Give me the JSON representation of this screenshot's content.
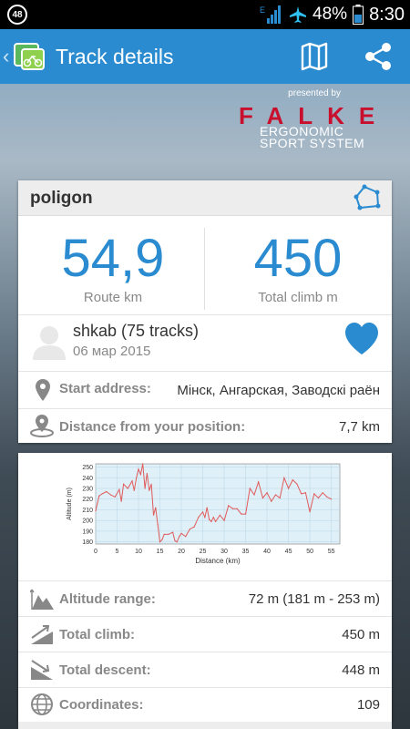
{
  "status_bar": {
    "notification_count": "48",
    "battery_percent": "48%",
    "time": "8:30",
    "network_type": "E",
    "icons": [
      "signal-icon",
      "airplane-icon",
      "battery-icon"
    ]
  },
  "action_bar": {
    "title": "Track details",
    "icons": [
      "back-icon",
      "app-logo-icon",
      "map-icon",
      "share-icon"
    ]
  },
  "sponsor": {
    "presented_by": "presented by",
    "brand": "FALKE",
    "brand_line1": "ERGONOMIC",
    "brand_line2": "SPORT SYSTEM"
  },
  "track": {
    "name": "poligon",
    "route_km": "54,9",
    "route_km_label": "Route km",
    "total_climb": "450",
    "total_climb_label": "Total climb m",
    "user_name": "shkab (75 tracks)",
    "date": "06 мар 2015",
    "rows": [
      {
        "label": "Start address:",
        "value": "Мінск, Ангарская, Заводскі раён",
        "icon": "pin-icon"
      },
      {
        "label": "Distance from your position:",
        "value": "7,7 km",
        "icon": "location-distance-icon"
      }
    ]
  },
  "stats": {
    "rows": [
      {
        "label": "Altitude range:",
        "value": "72 m (181 m - 253 m)",
        "icon": "mountain-icon"
      },
      {
        "label": "Total climb:",
        "value": "450 m",
        "icon": "climb-icon"
      },
      {
        "label": "Total descent:",
        "value": "448 m",
        "icon": "descent-icon"
      },
      {
        "label": "Coordinates:",
        "value": "109",
        "icon": "globe-icon"
      }
    ]
  },
  "chart_data": {
    "type": "line",
    "xlabel": "Distance (km)",
    "ylabel": "Altitude (m)",
    "xlim": [
      0,
      57
    ],
    "ylim": [
      178,
      253
    ],
    "x_ticks": [
      0,
      5,
      10,
      15,
      20,
      25,
      30,
      35,
      40,
      45,
      50,
      55
    ],
    "y_ticks": [
      180,
      190,
      200,
      210,
      220,
      230,
      240,
      250
    ],
    "grid": true,
    "color": "#e05a5a",
    "background": "#dff0f8",
    "series": [
      {
        "x": [
          0,
          0.8,
          1.5,
          2.5,
          3.5,
          4.5,
          5.5,
          6,
          6.5,
          7.5,
          8.5,
          9,
          9.5,
          10,
          10.5,
          11,
          11.5,
          12,
          12.5,
          13,
          13.5,
          14,
          14.5,
          15,
          15.5,
          16,
          17,
          18,
          18.5,
          19,
          19.5,
          20,
          21,
          22,
          23,
          24,
          25,
          25.5,
          26,
          26.5,
          27,
          27.5,
          28,
          29,
          30,
          31,
          32,
          33,
          34,
          35,
          36,
          37,
          38,
          39,
          40,
          41,
          42,
          43,
          44,
          45,
          46,
          47,
          48,
          49,
          50,
          51,
          52,
          53,
          54,
          55
        ],
        "y": [
          209,
          223,
          225,
          227,
          224,
          222,
          229,
          218,
          234,
          230,
          237,
          228,
          240,
          248,
          243,
          253,
          230,
          244,
          228,
          234,
          205,
          212,
          196,
          180,
          182,
          187,
          187,
          189,
          181,
          180,
          185,
          188,
          185,
          192,
          194,
          203,
          208,
          203,
          212,
          201,
          199,
          203,
          199,
          205,
          200,
          214,
          211,
          211,
          206,
          206,
          230,
          224,
          236,
          221,
          226,
          218,
          224,
          221,
          240,
          230,
          238,
          234,
          225,
          226,
          208,
          225,
          221,
          226,
          222,
          220
        ]
      }
    ]
  }
}
